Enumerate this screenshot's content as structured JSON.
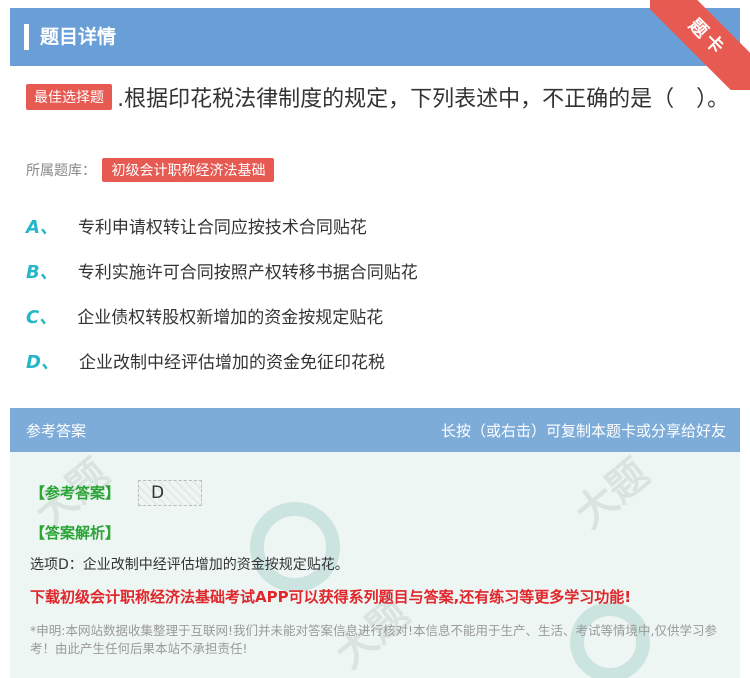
{
  "header": {
    "title": "题目详情"
  },
  "ribbon": {
    "label": "题卡"
  },
  "question": {
    "badge": "最佳选择题",
    "text": ".根据印花税法律制度的规定，下列表述中，不正确的是（　）。",
    "bank_label": "所属题库：",
    "bank_name": "初级会计职称经济法基础"
  },
  "options": [
    {
      "letter": "A、",
      "text": "专利申请权转让合同应按技术合同贴花"
    },
    {
      "letter": "B、",
      "text": "专利实施许可合同按照产权转移书据合同贴花"
    },
    {
      "letter": "C、",
      "text": "企业债权转股权新增加的资金按规定贴花"
    },
    {
      "letter": "D、",
      "text": "企业改制中经评估增加的资金免征印花税"
    }
  ],
  "answer_section": {
    "header_left": "参考答案",
    "header_right": "长按（或右击）可复制本题卡或分享给好友",
    "answer_label": "【参考答案】",
    "answer_value": "D",
    "analysis_label": "【答案解析】",
    "analysis_text": "选项D：企业改制中经评估增加的资金按规定贴花。",
    "promo": "下载初级会计职称经济法基础考试APP可以获得系列题目与答案,还有练习等更多学习功能!",
    "disclaimer": "*申明:本网站数据收集整理于互联网!我们并未能对答案信息进行核对!本信息不能用于生产、生活、考试等情境中,仅供学习参考！由此产生任何后果本站不承担责任!"
  },
  "colors": {
    "header_bg": "#6a9ed6",
    "badge_red": "#e75a52",
    "option_letter": "#27b6c8",
    "answer_green": "#2aa535",
    "promo_red": "#e0262a"
  }
}
